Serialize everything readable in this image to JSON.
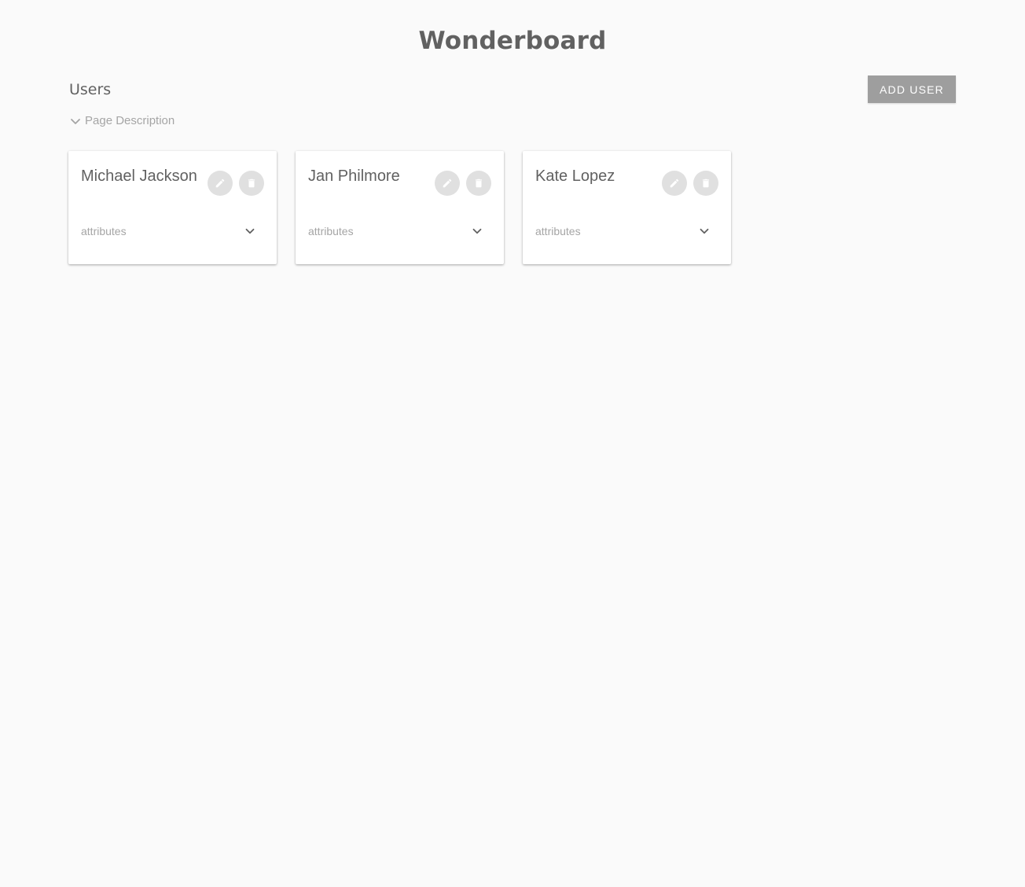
{
  "app": {
    "title": "Wonderboard"
  },
  "section": {
    "title": "Users",
    "add_button_label": "ADD USER",
    "page_description_label": "Page Description"
  },
  "users": [
    {
      "name": "Michael Jackson",
      "attributes_label": "attributes"
    },
    {
      "name": "Jan Philmore",
      "attributes_label": "attributes"
    },
    {
      "name": "Kate Lopez",
      "attributes_label": "attributes"
    }
  ],
  "icons": {
    "edit": "pencil-icon",
    "delete": "trash-icon",
    "expand": "chevron-down-icon"
  },
  "colors": {
    "background": "#fafafa",
    "text": "#616161",
    "muted_text": "#a5a5a5",
    "button": "#9e9e9e",
    "icon_button": "#e0e0e0"
  }
}
